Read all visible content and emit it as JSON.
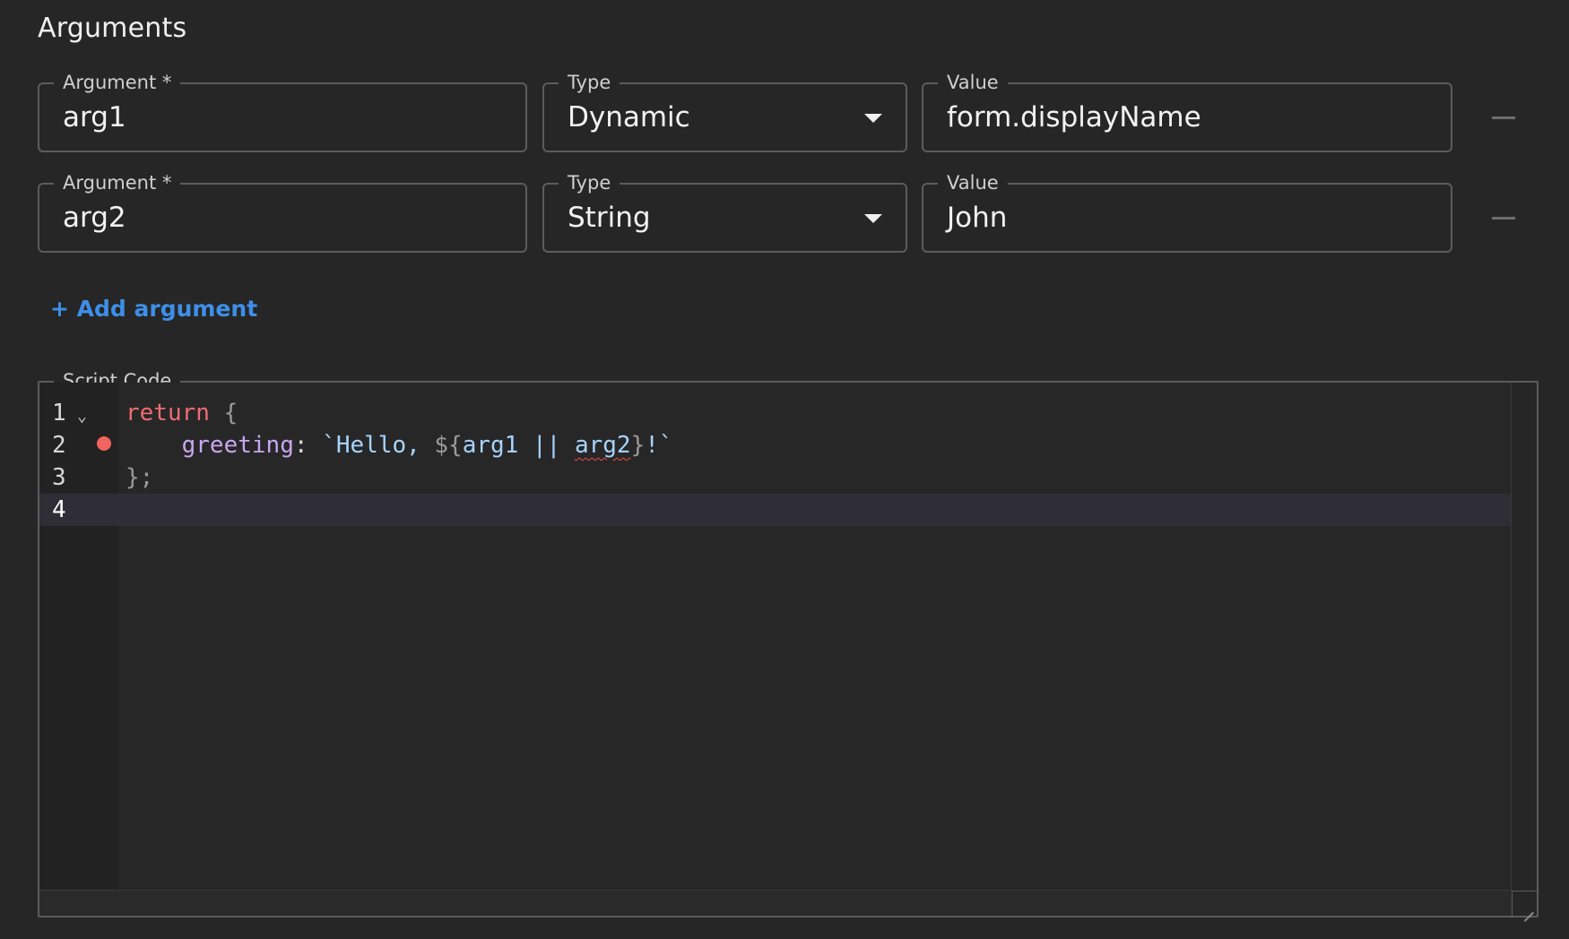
{
  "section_title": "Arguments",
  "arguments": [
    {
      "argument_label": "Argument *",
      "argument_value": "arg1",
      "type_label": "Type",
      "type_value": "Dynamic",
      "value_label": "Value",
      "value_value": "form.displayName"
    },
    {
      "argument_label": "Argument *",
      "argument_value": "arg2",
      "type_label": "Type",
      "type_value": "String",
      "value_label": "Value",
      "value_value": "John"
    }
  ],
  "add_argument_label": "+ Add argument",
  "script": {
    "legend": "Script Code",
    "line_numbers": [
      "1",
      "2",
      "3",
      "4"
    ],
    "fold_icon": "chevron-down-icon",
    "breakpoint_color": "#f2625f",
    "active_line": 4,
    "tokens": {
      "l1_kw": "return",
      "l1_brace": " {",
      "l2_indent": "    ",
      "l2_prop": "greeting",
      "l2_colon": ": ",
      "l2_str_open": "`Hello, ",
      "l2_interp_open": "${",
      "l2_id1": "arg1",
      "l2_op": " || ",
      "l2_id2": "arg2",
      "l2_interp_close": "}",
      "l2_str_close": "!`",
      "l3_close": "};"
    }
  },
  "colors": {
    "background": "#262626",
    "accent_link": "#3d8fe8",
    "border": "#5c5c5c"
  }
}
